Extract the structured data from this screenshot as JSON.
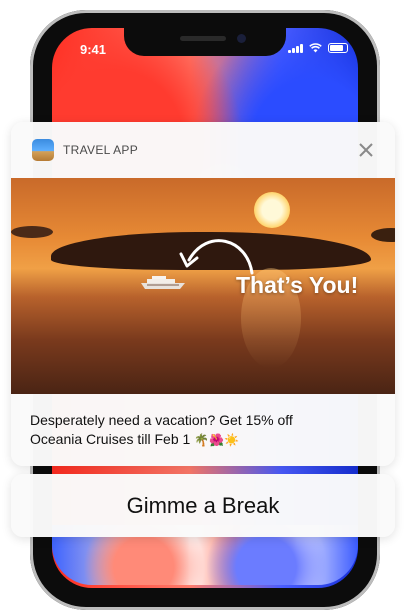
{
  "status_bar": {
    "time": "9:41",
    "icons": [
      "signal-icon",
      "wifi-icon",
      "battery-icon"
    ]
  },
  "notification": {
    "app_name": "TRAVEL APP",
    "app_icon": "travel-app-icon",
    "close_icon": "close-icon",
    "image_overlay_text": "That’s You!",
    "message_line1": "Desperately need a vacation? Get 15% off",
    "message_line2": "Oceania Cruises till Feb 1",
    "message_emoji": "🌴🌺☀️"
  },
  "action": {
    "label": "Gimme a Break"
  },
  "colors": {
    "card_bg": "#fafafa",
    "text": "#111111",
    "subtle_text": "#4a4a4a"
  }
}
